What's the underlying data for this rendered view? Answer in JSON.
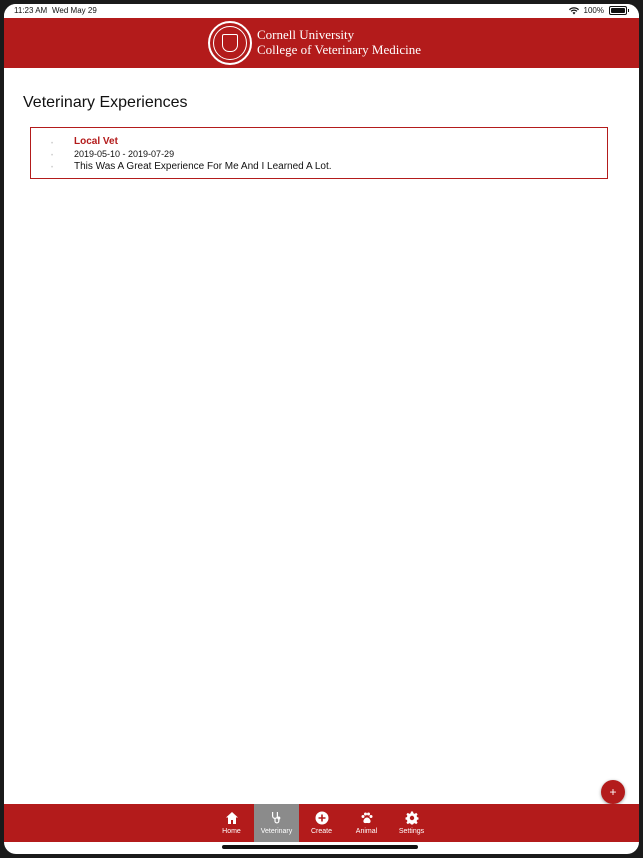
{
  "status_bar": {
    "time": "11:23 AM",
    "date": "Wed May 29",
    "battery": "100%"
  },
  "header": {
    "line1": "Cornell University",
    "line2": "College of Veterinary Medicine",
    "seal_text": "CORNELL UNIVERSITY FOUNDED A.D. 1865"
  },
  "page": {
    "title": "Veterinary Experiences"
  },
  "experiences": [
    {
      "name": "Local Vet",
      "dates": "2019-05-10 - 2019-07-29",
      "description": "This Was A Great Experience For Me And I Learned A Lot."
    }
  ],
  "fab": {
    "label": "+"
  },
  "tabs": [
    {
      "label": "Home",
      "icon": "home-icon"
    },
    {
      "label": "Veterinary",
      "icon": "stethoscope-icon",
      "active": true
    },
    {
      "label": "Create",
      "icon": "plus-circle-icon"
    },
    {
      "label": "Animal",
      "icon": "paw-icon"
    },
    {
      "label": "Settings",
      "icon": "gear-icon"
    }
  ],
  "colors": {
    "brand": "#b31b1b",
    "active_tab": "#8b8b8b"
  }
}
